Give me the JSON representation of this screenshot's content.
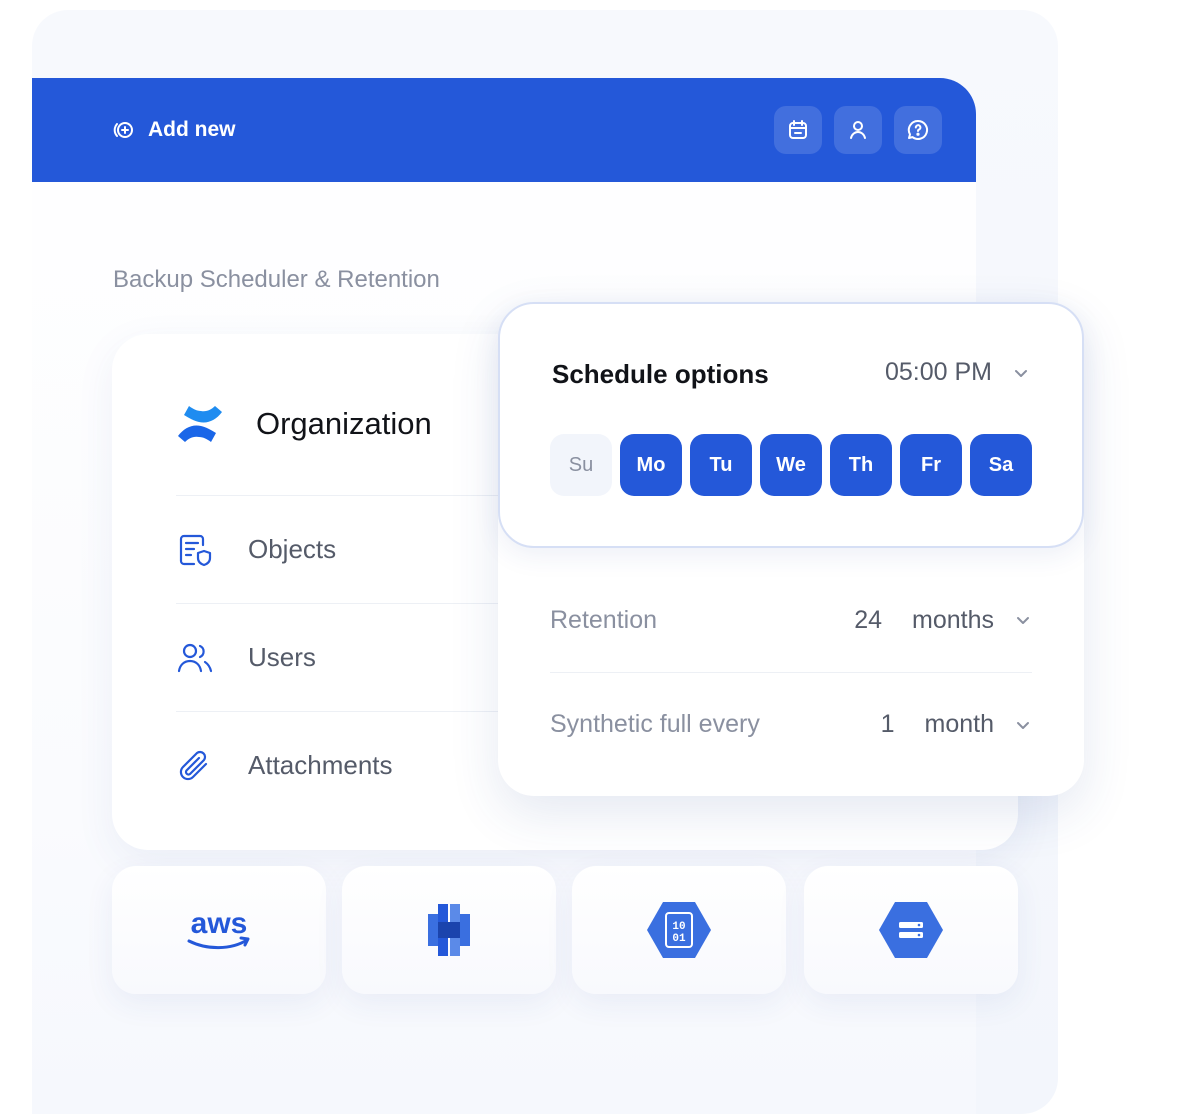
{
  "topbar": {
    "add_new_label": "Add new",
    "background": "#2458d9",
    "buttons": [
      "calendar-icon",
      "user-icon",
      "help-icon"
    ]
  },
  "section_title": "Backup Scheduler & Retention",
  "organization": {
    "title": "Organization",
    "items": [
      {
        "label": "Objects",
        "icon": "document-shield-icon"
      },
      {
        "label": "Users",
        "icon": "users-icon"
      },
      {
        "label": "Attachments",
        "icon": "paperclip-icon"
      }
    ]
  },
  "schedule": {
    "title": "Schedule options",
    "time": "05:00 PM",
    "days": [
      {
        "label": "Su",
        "selected": false
      },
      {
        "label": "Mo",
        "selected": true
      },
      {
        "label": "Tu",
        "selected": true
      },
      {
        "label": "We",
        "selected": true
      },
      {
        "label": "Th",
        "selected": true
      },
      {
        "label": "Fr",
        "selected": true
      },
      {
        "label": "Sa",
        "selected": true
      }
    ]
  },
  "retention": {
    "label": "Retention",
    "value": "24",
    "unit": "months"
  },
  "synthetic": {
    "label": "Synthetic full every",
    "value": "1",
    "unit": "month"
  },
  "storage_providers": [
    {
      "name": "aws-logo-icon",
      "text": "aws"
    },
    {
      "name": "s3-bucket-icon"
    },
    {
      "name": "binary-storage-icon",
      "text": "10 01"
    },
    {
      "name": "cloud-storage-icon"
    }
  ],
  "colors": {
    "accent": "#2458d9",
    "muted_text": "#8a90a0",
    "body_text": "#555b69"
  }
}
